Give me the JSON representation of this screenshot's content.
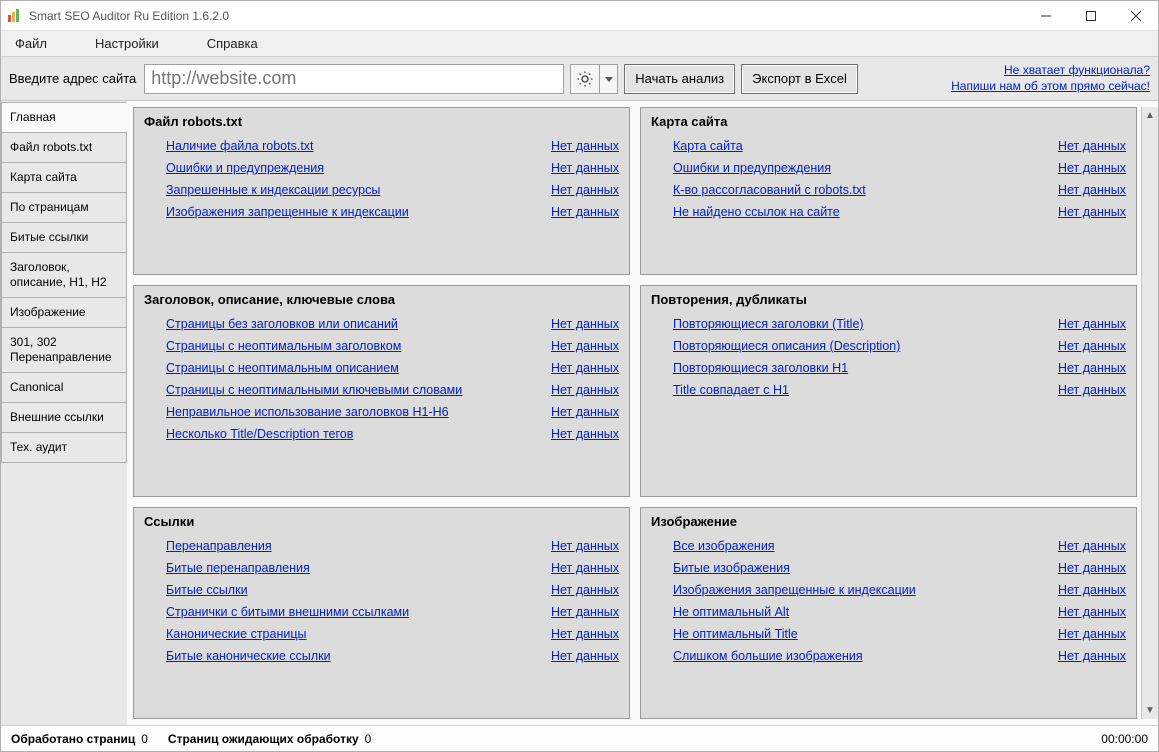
{
  "window": {
    "title": "Smart SEO Auditor Ru Edition 1.6.2.0"
  },
  "menu": {
    "file": "Файл",
    "settings": "Настройки",
    "help": "Справка"
  },
  "toolbar": {
    "url_label": "Введите адрес сайта",
    "url_placeholder": "http://website.com",
    "start_label": "Начать анализ",
    "export_label": "Экспорт в Excel",
    "promo_line1": "Не хватает функционала?",
    "promo_line2": "Напиши нам об этом прямо сейчас!"
  },
  "sidebar": {
    "items": [
      {
        "label": "Главная",
        "active": true
      },
      {
        "label": "Файл robots.txt"
      },
      {
        "label": "Карта сайта"
      },
      {
        "label": "По страницам"
      },
      {
        "label": "Битые ссылки"
      },
      {
        "label": "Заголовок, описание, H1, H2"
      },
      {
        "label": "Изображение"
      },
      {
        "label": "301, 302 Перенаправление"
      },
      {
        "label": "Canonical"
      },
      {
        "label": "Внешние ссылки"
      },
      {
        "label": "Тех. аудит"
      }
    ]
  },
  "no_data": "Нет данных",
  "panels": [
    {
      "title": "Файл robots.txt",
      "rows": [
        "Наличие файла robots.txt",
        "Ошибки и предупреждения",
        "Запрешенные к индексации ресурсы",
        "Изображения запрещенные к индексации"
      ]
    },
    {
      "title": "Карта сайта",
      "rows": [
        "Карта сайта",
        "Ошибки и предупреждения",
        "К-во рассогласований с robots.txt",
        "Не найдено ссылок на сайте"
      ]
    },
    {
      "title": "Заголовок, описание, ключевые слова",
      "rows": [
        "Страницы без заголовков или описаний",
        "Страницы с неоптимальным заголовком",
        "Страницы с неоптимальным описанием",
        "Страницы с неоптимальными ключевыми словами",
        "Неправильное использование заголовков H1-H6",
        "Несколько Title/Description тегов"
      ]
    },
    {
      "title": "Повторения, дубликаты",
      "rows": [
        "Повторяющиеся заголовки (Title)",
        "Повторяющиеся описания (Description)",
        "Повторяющиеся заголовки H1",
        "Title совпадает с H1"
      ]
    },
    {
      "title": "Ссылки",
      "rows": [
        "Перенаправления",
        "Битые перенаправления",
        "Битые ссылки",
        "Странички с битыми внешними ссылками",
        "Канонические страницы",
        "Битые канонические ссылки"
      ]
    },
    {
      "title": "Изображение",
      "rows": [
        "Все изображения",
        "Битые изображения",
        "Изображения запрещенные к индексации",
        "Не оптимальный Alt",
        "Не оптимальный Title",
        "Слишком большие изображения"
      ]
    }
  ],
  "status": {
    "processed_label": "Обработано страниц",
    "processed_value": "0",
    "pending_label": "Страниц ожидающих обработку",
    "pending_value": "0",
    "time": "00:00:00"
  }
}
